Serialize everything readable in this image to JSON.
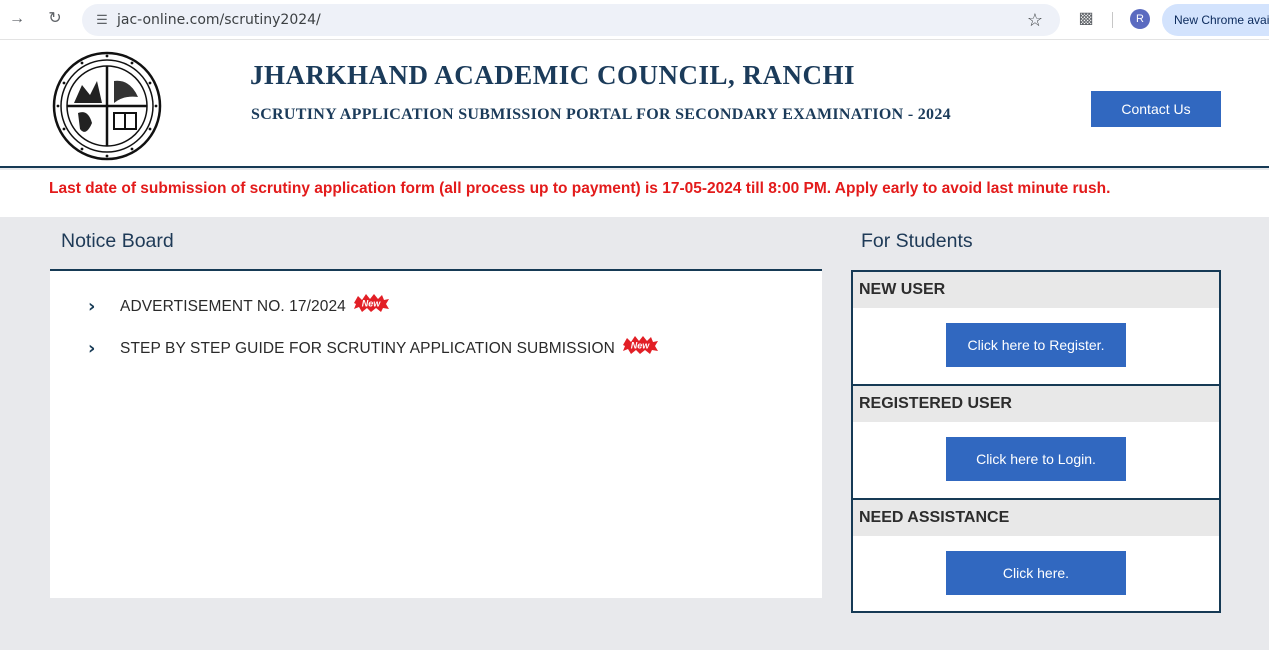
{
  "browser": {
    "url": "jac-online.com/scrutiny2024/",
    "profile_initial": "R",
    "update_pill": "New Chrome available"
  },
  "header": {
    "org_name": "JHARKHAND ACADEMIC COUNCIL, RANCHI",
    "portal_name": "SCRUTINY APPLICATION SUBMISSION PORTAL FOR SECONDARY EXAMINATION - 2024",
    "contact_label": "Contact Us"
  },
  "alert": {
    "text": "Last date of submission of scrutiny application form (all process up to payment) is 17-05-2024 till 8:00 PM. Apply early to avoid last minute rush."
  },
  "notice_board": {
    "title": "Notice Board",
    "badge_label": "New",
    "items": [
      {
        "label": "ADVERTISEMENT NO. 17/2024"
      },
      {
        "label": "STEP BY STEP GUIDE FOR SCRUTINY APPLICATION SUBMISSION"
      }
    ]
  },
  "students": {
    "title": "For Students",
    "sections": [
      {
        "heading": "NEW USER",
        "button": "Click here to Register."
      },
      {
        "heading": "REGISTERED USER",
        "button": "Click here to Login."
      },
      {
        "heading": "NEED ASSISTANCE",
        "button": "Click here."
      }
    ]
  },
  "colors": {
    "brand_navy": "#163a55",
    "button_blue": "#3168c0",
    "alert_red": "#e31b1b",
    "badge_red": "#e21f26"
  },
  "icons": [
    "back-arrow-icon",
    "reload-icon",
    "site-settings-icon",
    "bookmark-star-icon",
    "extensions-icon",
    "chevron-right-icon",
    "new-badge-icon",
    "jac-emblem-logo"
  ]
}
